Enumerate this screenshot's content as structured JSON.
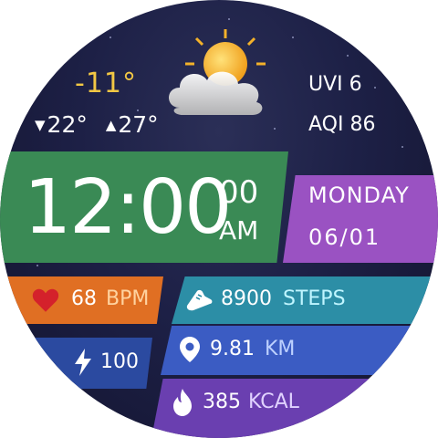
{
  "weather": {
    "temperature": "-11°",
    "low": "22°",
    "high": "27°",
    "uvi": "UVI 6",
    "aqi": "AQI 86",
    "icon": "partly-cloudy-icon"
  },
  "time": {
    "main": "12:00",
    "seconds": "00",
    "ampm": "AM"
  },
  "date": {
    "day": "MONDAY",
    "date": "06/01"
  },
  "heart_rate": {
    "value": "68",
    "unit": "BPM",
    "icon": "heart-icon"
  },
  "battery": {
    "value": "100",
    "icon": "lightning-icon"
  },
  "steps": {
    "value": "8900",
    "unit": "STEPS",
    "icon": "shoe-icon"
  },
  "distance": {
    "value": "9.81",
    "unit": "KM",
    "icon": "location-pin-icon"
  },
  "calories": {
    "value": "385",
    "unit": "KCAL",
    "icon": "flame-icon"
  },
  "colors": {
    "accent_temp": "#f2c744",
    "time_band": "#3a8a55",
    "date_band": "#9a52c2",
    "heart_band": "#e06f23",
    "steps_band": "#2c8ea6",
    "battery_band": "#2b4aa0",
    "distance_band": "#3b5cc3",
    "calories_band": "#6a3fb0",
    "unit_text": "#8ee3f0"
  }
}
